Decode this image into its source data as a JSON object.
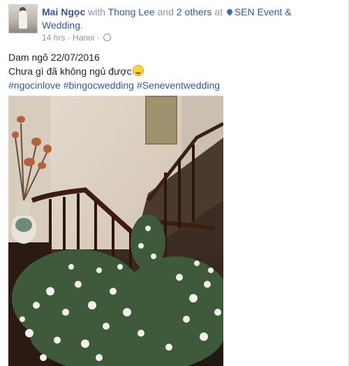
{
  "post": {
    "author": "Mai Ngọc",
    "with_word": "with",
    "tagged": "Thong Lee",
    "and_word": "and",
    "others": "2 others",
    "at_word": "at",
    "location": "SEN Event & Wedding",
    "period": ".",
    "time": "14 hrs",
    "sep": "·",
    "place": "Hanoi",
    "sep2": "·",
    "lines": [
      "Dam ngõ 22/07/2016",
      "Chưa gì đã không ngủ được"
    ],
    "hashtags": [
      "#ngocinlove",
      "#bingocwedding",
      "#Seneventwedding"
    ],
    "icons": {
      "location": "location-pin-icon",
      "privacy": "globe-icon",
      "emoji": "grinning-emoji-icon"
    },
    "colors": {
      "link": "#365899",
      "meta": "#90949c",
      "text": "#1d2129"
    }
  }
}
